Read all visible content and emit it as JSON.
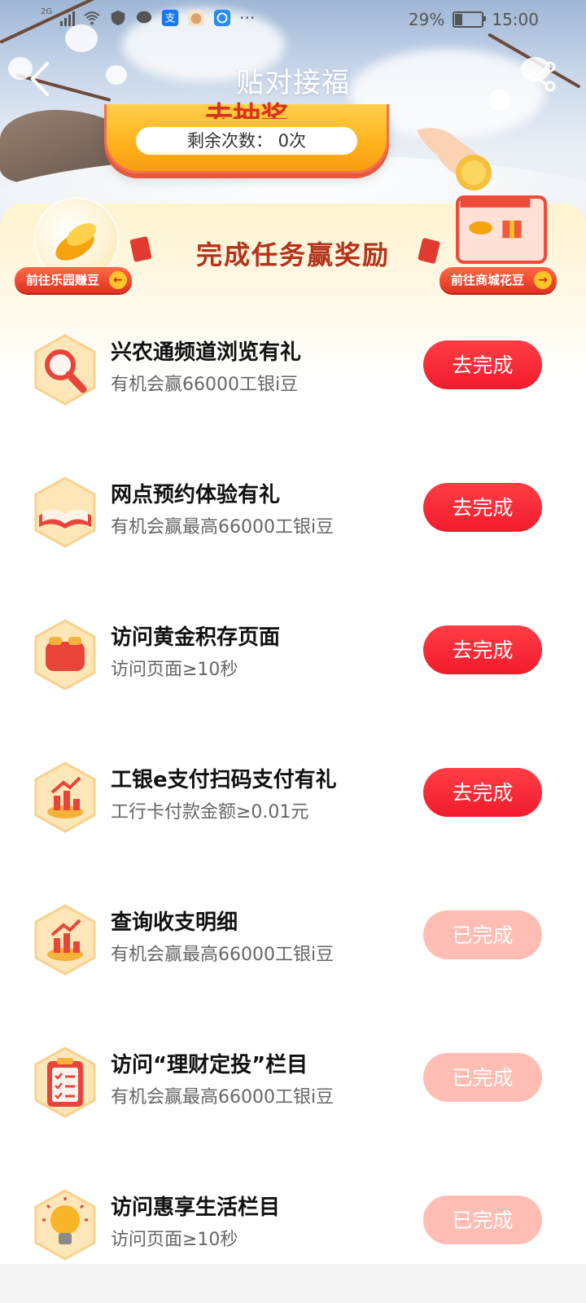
{
  "status_bar": {
    "network": "2G",
    "battery_percent": "29%",
    "time": "15:00",
    "battery_level": 0.29
  },
  "nav": {
    "title": "贴对接福"
  },
  "lottery": {
    "title": "去抽奖",
    "remaining_label": "剩余次数：",
    "remaining_value": "0次"
  },
  "panel": {
    "title": "完成任务赢奖励",
    "left_button": "前往乐园赚豆",
    "right_button": "前往商城花豆"
  },
  "tasks": [
    {
      "icon": "magnifier-icon",
      "title": "兴农通频道浏览有礼",
      "subtitle": "有机会赢66000工银i豆",
      "button": "去完成",
      "status": "todo"
    },
    {
      "icon": "book-icon",
      "title": "网点预约体验有礼",
      "subtitle": "有机会赢最高66000工银i豆",
      "button": "去完成",
      "status": "todo"
    },
    {
      "icon": "wallet-icon",
      "title": "访问黄金积存页面",
      "subtitle": "访问页面≥10秒",
      "button": "去完成",
      "status": "todo"
    },
    {
      "icon": "growth-chart-icon",
      "title": "工银e支付扫码支付有礼",
      "subtitle": "工行卡付款金额≥0.01元",
      "button": "去完成",
      "status": "todo"
    },
    {
      "icon": "growth-chart-icon",
      "title": "查询收支明细",
      "subtitle": "有机会赢最高66000工银i豆",
      "button": "已完成",
      "status": "done"
    },
    {
      "icon": "clipboard-icon",
      "title": "访问“理财定投”栏目",
      "subtitle": "有机会赢最高66000工银i豆",
      "button": "已完成",
      "status": "done"
    },
    {
      "icon": "lightbulb-icon",
      "title": "访问惠享生活栏目",
      "subtitle": "访问页面≥10秒",
      "button": "已完成",
      "status": "done"
    }
  ],
  "colors": {
    "accent_red": "#f21b2c",
    "done_pink": "#ffbdb4",
    "title_brown": "#b3331b"
  }
}
